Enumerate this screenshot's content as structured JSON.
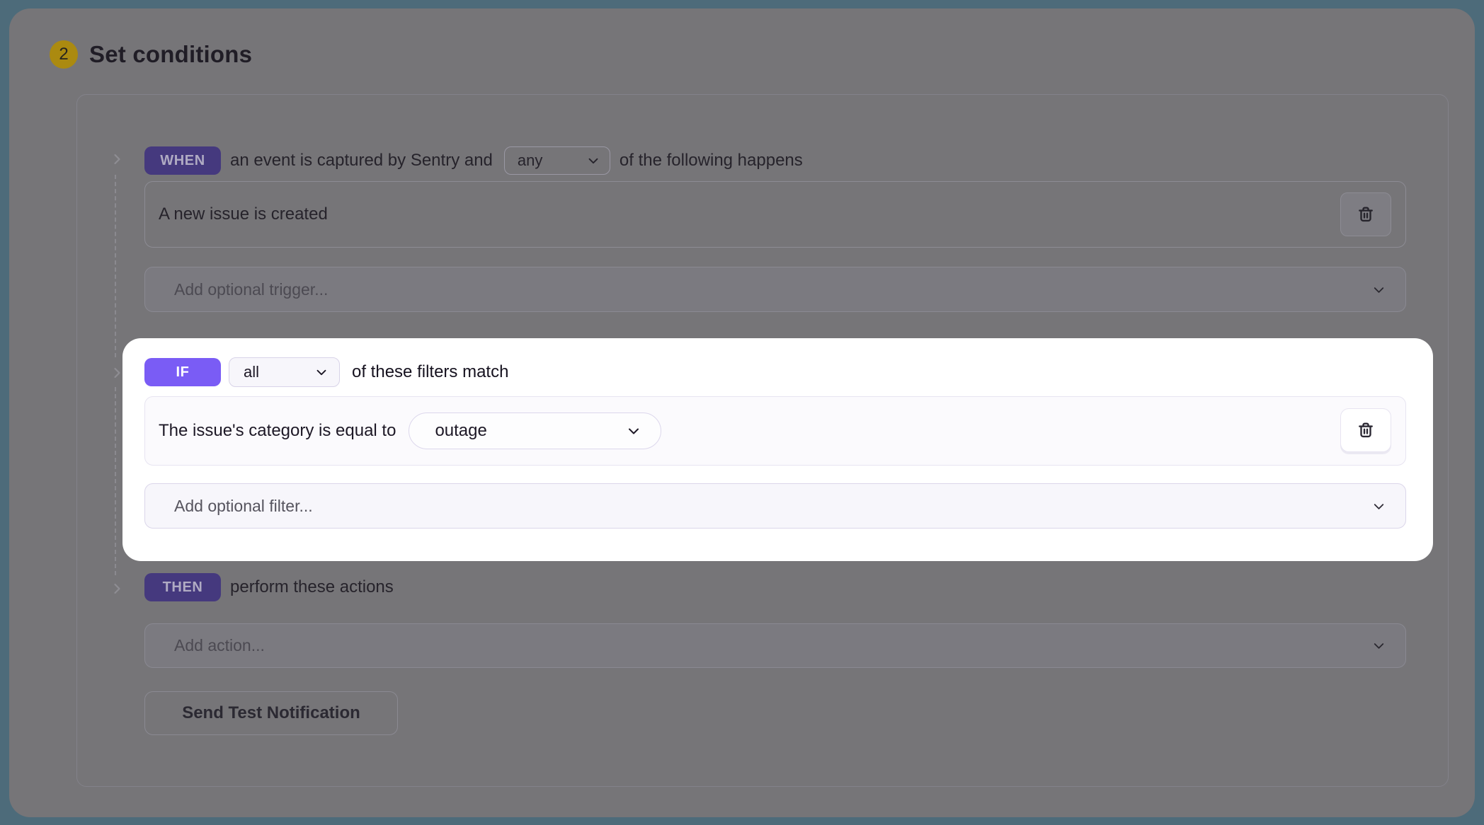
{
  "header": {
    "step_number": "2",
    "title": "Set conditions"
  },
  "when": {
    "badge": "WHEN",
    "text_before_select": "an event is captured by Sentry and",
    "select_value": "any",
    "text_after_select": "of the following happens",
    "condition": "A new issue is created",
    "add_placeholder": "Add optional trigger..."
  },
  "if": {
    "badge": "IF",
    "select_value": "all",
    "text_after_select": "of these filters match",
    "filter_text": "The issue's category is equal to",
    "filter_select_value": "outage",
    "add_placeholder": "Add optional filter..."
  },
  "then": {
    "badge": "THEN",
    "text": "perform these actions",
    "add_placeholder": "Add action...",
    "test_button": "Send Test Notification"
  },
  "colors": {
    "page_border_teal": "#4d6b7a",
    "dim_overlay_gray": "#767578",
    "spotlight_white": "#ffffff",
    "if_badge_purple": "#7a5cf5",
    "when_then_badge_purple": "#45397e",
    "step_badge_gold": "#ab8a10"
  },
  "icons": {
    "trash": "trash-icon",
    "chevron_down": "chevron-down-icon",
    "chevron_right": "chevron-right-icon"
  }
}
